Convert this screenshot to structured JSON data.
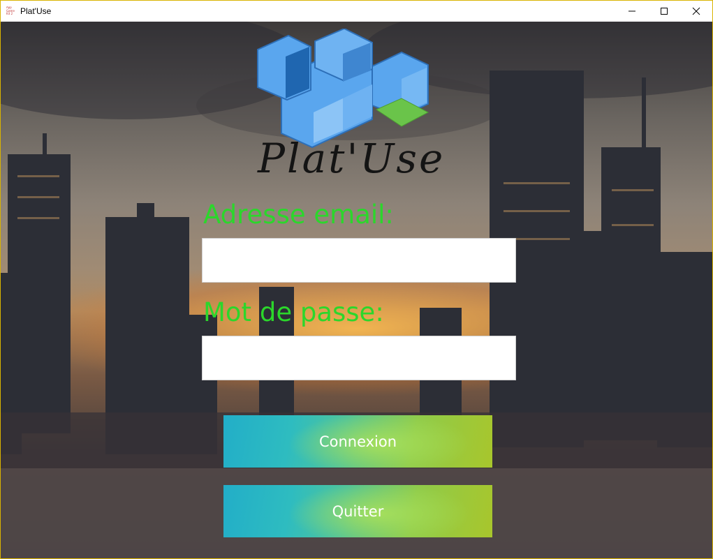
{
  "window": {
    "title": "Plat'Use",
    "app_icon_text": "App Game Kit 2",
    "controls": [
      "minimize-icon",
      "maximize-icon",
      "close-icon"
    ]
  },
  "logo": {
    "text": "Plat'Use",
    "colors": {
      "cube_blue": "#5aa6ee",
      "cube_dark": "#1f66b0",
      "cube_green": "#6ac44a"
    }
  },
  "form": {
    "email_label": "Adresse email:",
    "email_value": "",
    "password_label": "Mot de passe:",
    "password_value": "",
    "label_color": "#2bd72b"
  },
  "buttons": {
    "connect_label": "Connexion",
    "quit_label": "Quitter"
  }
}
